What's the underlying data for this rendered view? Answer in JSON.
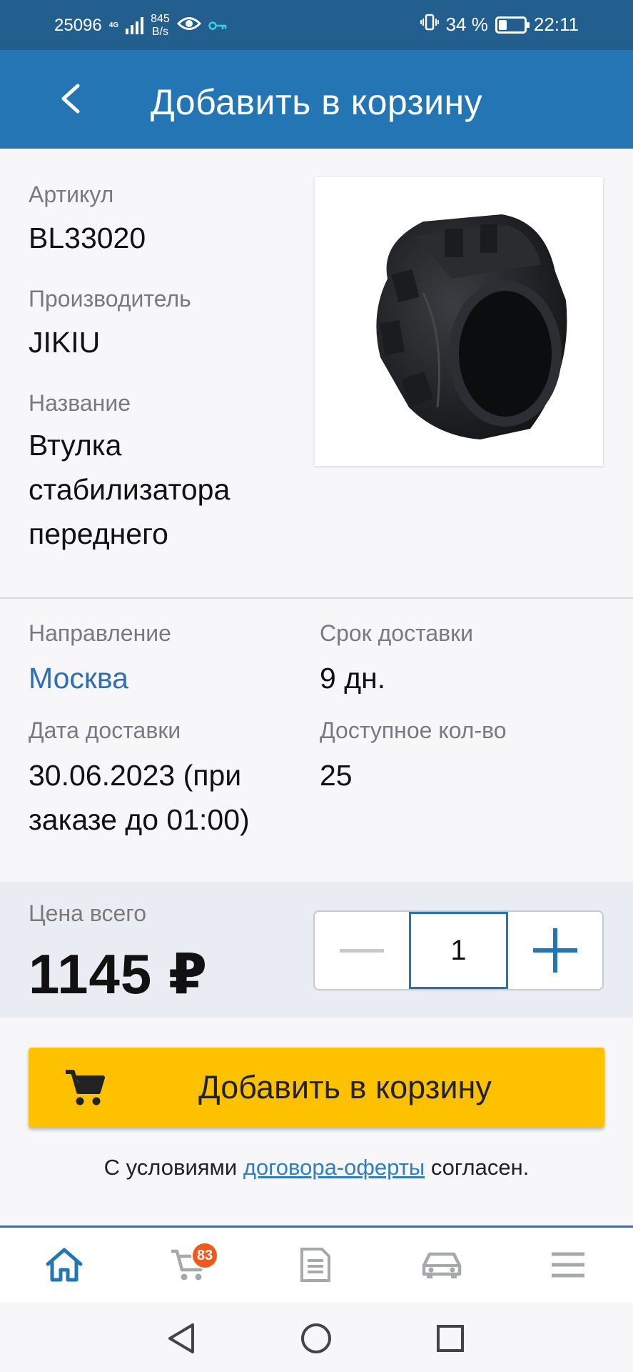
{
  "status_bar": {
    "speed_left": "25096",
    "network": "4G",
    "net_rate": "845",
    "net_rate_unit": "B/s",
    "battery": "34 %",
    "battery_level": 0.34,
    "time": "22:11"
  },
  "header": {
    "title": "Добавить в корзину",
    "back_icon": "chevron-left-icon"
  },
  "product": {
    "article_label": "Артикул",
    "article": "BL33020",
    "manufacturer_label": "Производитель",
    "manufacturer": "JIKIU",
    "name_label": "Название",
    "name_lines": [
      "Втулка",
      "стабилизатора",
      "переднего"
    ]
  },
  "delivery": {
    "direction_label": "Направление",
    "direction": "Москва",
    "term_label": "Срок доставки",
    "term": "9 дн.",
    "date_label": "Дата доставки",
    "date_lines": [
      "30.06.2023 (при",
      "заказе до 01:00)"
    ],
    "available_label": "Доступное кол-во",
    "available": "25"
  },
  "price": {
    "label": "Цена всего",
    "value": "1145 ₽",
    "quantity": "1"
  },
  "cart_button": {
    "label": "Добавить в корзину",
    "icon": "cart-icon"
  },
  "agreement": {
    "prefix": "С условиями ",
    "link": "договора-оферты",
    "suffix": " согласен."
  },
  "bottom_nav": {
    "cart_badge": "83",
    "items": [
      "home-icon",
      "cart-icon",
      "orders-icon",
      "car-icon",
      "menu-icon"
    ]
  },
  "colors": {
    "header": "#2375b3",
    "status": "#225f8f",
    "accent_button": "#fdc100",
    "link": "#2f6db5",
    "badge": "#ee5a1c"
  }
}
